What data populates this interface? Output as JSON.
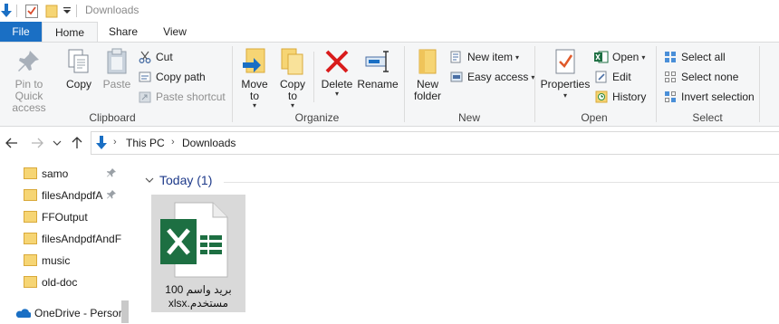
{
  "window": {
    "title": "Downloads"
  },
  "quick_access_toolbar": {
    "icons": [
      "downloads-arrow-icon",
      "properties-check-icon",
      "new-folder-icon",
      "customize-dropdown-icon"
    ]
  },
  "ribbon_tabs": {
    "file": "File",
    "home": "Home",
    "share": "Share",
    "view": "View"
  },
  "clipboard": {
    "pin_to_quick_access": "Pin to Quick access",
    "copy": "Copy",
    "paste": "Paste",
    "cut": "Cut",
    "copy_path": "Copy path",
    "paste_shortcut": "Paste shortcut",
    "label": "Clipboard"
  },
  "organize": {
    "move_to": "Move to",
    "copy_to": "Copy to",
    "delete": "Delete",
    "rename": "Rename",
    "label": "Organize"
  },
  "new_group": {
    "new_folder": "New folder",
    "new_item": "New item",
    "easy_access": "Easy access",
    "label": "New"
  },
  "open_group": {
    "properties": "Properties",
    "open": "Open",
    "edit": "Edit",
    "history": "History",
    "label": "Open"
  },
  "select_group": {
    "select_all": "Select all",
    "select_none": "Select none",
    "invert_selection": "Invert selection",
    "label": "Select"
  },
  "address": {
    "this_pc": "This PC",
    "downloads": "Downloads"
  },
  "nav_pane": {
    "items": [
      {
        "label": "samo",
        "pinned": true
      },
      {
        "label": "filesAndpdfA",
        "pinned": true
      },
      {
        "label": "FFOutput",
        "pinned": false
      },
      {
        "label": "filesAndpdfAndF",
        "pinned": false
      },
      {
        "label": "music",
        "pinned": false
      },
      {
        "label": "old-doc",
        "pinned": false
      }
    ],
    "onedrive": "OneDrive - Persor"
  },
  "content": {
    "group_header": "Today (1)",
    "file": {
      "name": "بريد واسم 100 مستخدم.xlsx",
      "line1": "بريد واسم 100",
      "line2": "مستخدم.xlsx"
    }
  },
  "colors": {
    "file_tab": "#1a6fc4",
    "excel_green": "#1d6f42",
    "delete_red": "#d91c1c",
    "folder_yellow": "#f6d574",
    "selection": "#d9d9d9"
  }
}
